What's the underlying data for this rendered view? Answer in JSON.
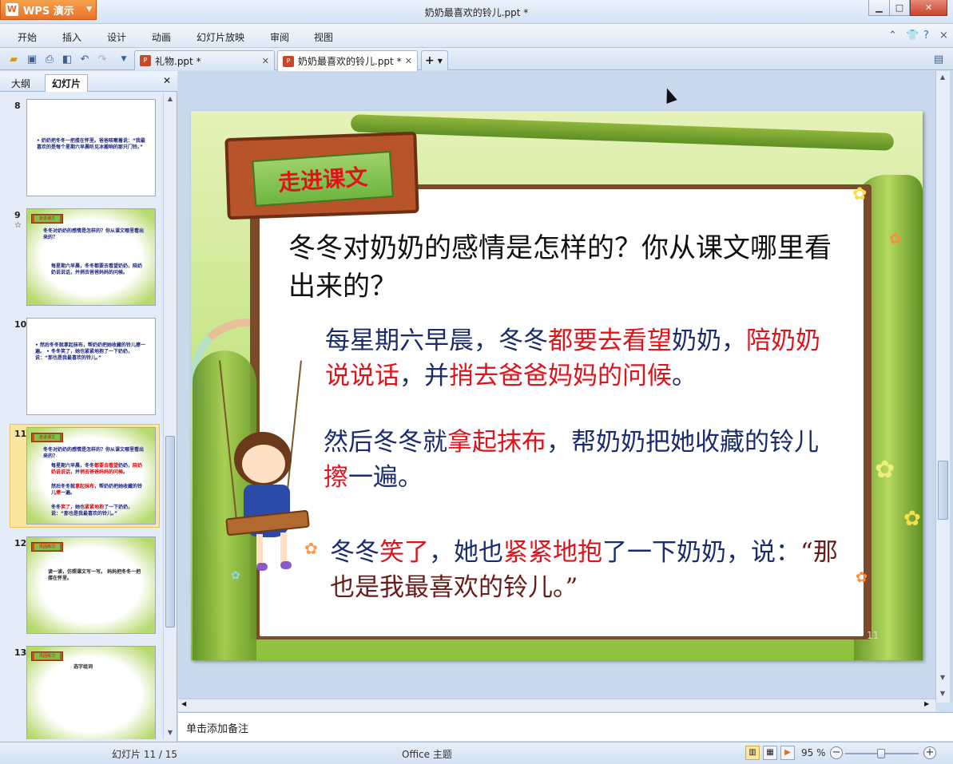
{
  "app": {
    "brand": "WPS 演示",
    "window_title": "奶奶最喜欢的铃儿.ppt *"
  },
  "menu": [
    "开始",
    "插入",
    "设计",
    "动画",
    "幻灯片放映",
    "审阅",
    "视图"
  ],
  "tabs": [
    {
      "label": "礼物.ppt *",
      "active": false
    },
    {
      "label": "奶奶最喜欢的铃儿.ppt *",
      "active": true
    }
  ],
  "left_panel": {
    "tabs": [
      "大纲",
      "幻灯片"
    ],
    "active_tab": "幻灯片",
    "thumbnails": [
      {
        "num": "8",
        "text": "• 奶奶把冬冬一把搂在怀里。爸爸咳嗽着说：“我最喜欢的是每个星期六早晨听见冰搬响的那只门铃。”"
      },
      {
        "num": "9",
        "banner": "走进课文",
        "text1": "冬冬对奶奶的感情是怎样的？你从课文哪里看出来的？",
        "text2": "每星期六早晨，冬冬都要去看望奶奶，陪奶奶说说话，并捎去爸爸妈妈的问候。"
      },
      {
        "num": "10",
        "text": "• 然后冬冬就拿起抹布，帮奶奶把她收藏的铃儿擦一遍。 • 冬冬笑了，她也紧紧地抱了一下奶奶，说：“那也是我最喜欢的铃儿。”"
      },
      {
        "num": "11",
        "banner": "走进课文",
        "selected": true
      },
      {
        "num": "12",
        "banner": "巩固练习",
        "text": "读一读，仿照课文写一写。 妈妈把冬冬一把搂在怀里。"
      },
      {
        "num": "13",
        "banner": "巩固练习",
        "text": "选字组词"
      }
    ]
  },
  "slide": {
    "banner": "走进课文",
    "question": "冬冬对奶奶的感情是怎样的？你从课文哪里看出来的？",
    "p1": {
      "a": "每星期六早晨，冬冬",
      "b": "都要去看望",
      "c": "奶奶，",
      "d": "陪奶奶说说话",
      "e": "，并",
      "f": "捎去爸爸妈妈的问候",
      "g": "。"
    },
    "p2": {
      "a": "然后冬冬就",
      "b": "拿起抹布",
      "c": "，帮奶奶把她收藏的铃儿",
      "d": "擦",
      "e": "一遍。"
    },
    "p3": {
      "a": "冬冬",
      "b": "笑了",
      "c": "，她也",
      "d": "紧紧地抱",
      "e": "了一下奶奶，说：",
      "f": "“那也是我最喜欢的铃儿。”"
    },
    "page_number": "11"
  },
  "notes_placeholder": "单击添加备注",
  "status": {
    "slide_counter": "幻灯片 11 / 15",
    "theme": "Office 主题",
    "zoom": "95 %",
    "zoom_level": 0.95
  }
}
